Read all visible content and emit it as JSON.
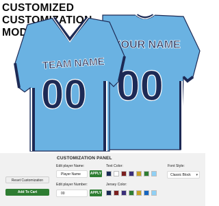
{
  "header": {
    "line1": "CUSTOMIZED",
    "line2": "CUSTOMIZATION",
    "line3": "MODULE"
  },
  "jersey": {
    "front_team_name": "TEAM NAME",
    "front_number": "00",
    "back_player_name": "YOUR NAME",
    "back_number": "00",
    "colors": {
      "body": "#6ab2e2",
      "trim": "#1d2a55",
      "accent": "#ffffff",
      "text": "#1d2a55"
    }
  },
  "panel": {
    "title": "CUSTOMIZATION PANEL",
    "player_name_label": "Edit player Name:",
    "player_name_value": "Player Name",
    "player_number_label": "Edit player Number:",
    "player_number_value": "00",
    "apply_label": "APPLY",
    "text_color_label": "Text Color:",
    "jersey_color_label": "Jersey Color:",
    "font_style_label": "Font Style:",
    "font_style_value": "Classic Block",
    "text_colors": [
      "#1b2a57",
      "#ffffff",
      "#7b1f1f",
      "#3a2e7a",
      "#c7a227",
      "#2e7d32",
      "#8fd0f5"
    ],
    "jersey_colors": [
      "#1b2a57",
      "#7b1f1f",
      "#3a2e7a",
      "#2e7d32",
      "#c7a227",
      "#1565c0",
      "#8fd0f5"
    ]
  },
  "buttons": {
    "reset": "Reset Customization",
    "add_to_cart": "Add To Cart"
  }
}
